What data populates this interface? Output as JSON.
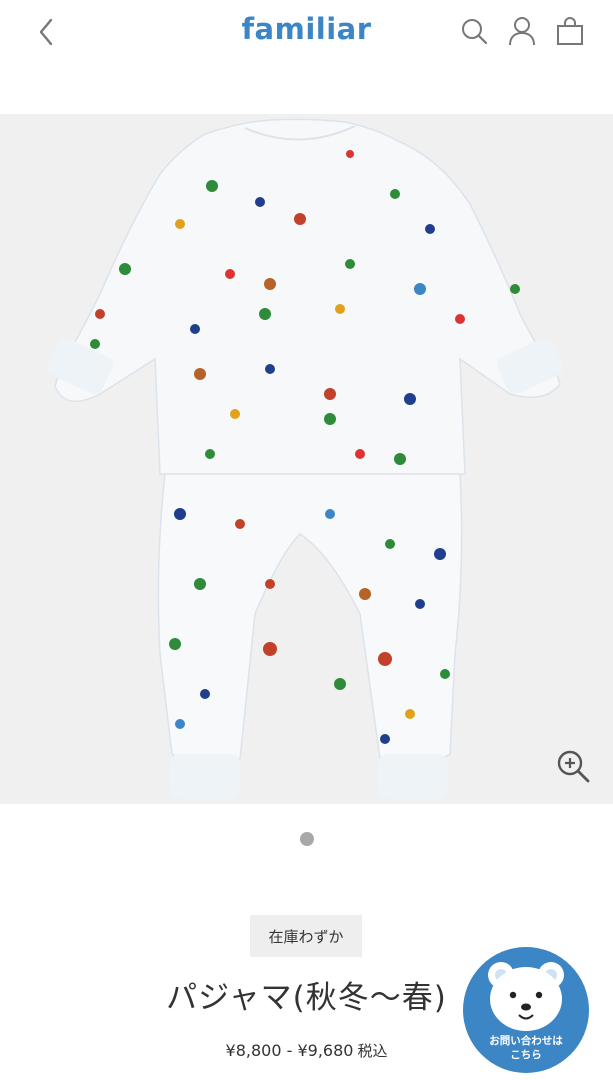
{
  "header": {
    "logo_text": "familiar",
    "brand_color": "#3d86c6"
  },
  "product": {
    "stock_badge": "在庫わずか",
    "title": "パジャマ(秋冬～春)",
    "price_range": "¥8,800 - ¥9,680",
    "tax_label": "税込"
  },
  "gallery": {
    "active_dot_color": "#a8a8a8"
  },
  "contact_button": {
    "line1": "お問い合わせは",
    "line2": "こちら"
  },
  "icons": [
    "chevron-left-icon",
    "search-icon",
    "user-icon",
    "bag-icon",
    "zoom-in-icon"
  ]
}
